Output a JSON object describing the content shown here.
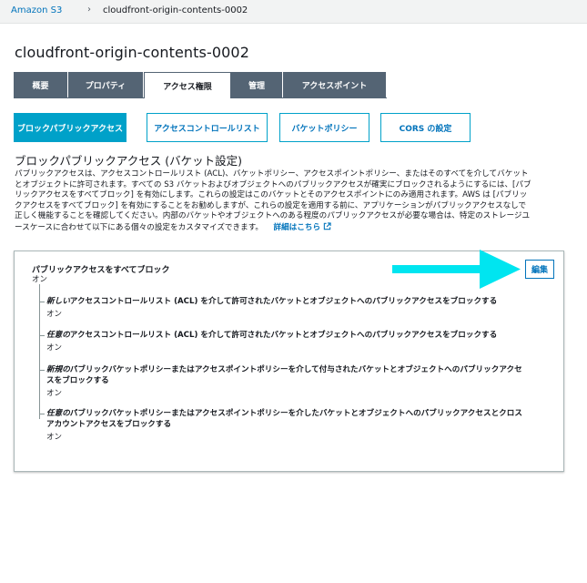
{
  "breadcrumb": {
    "root": "Amazon S3",
    "separator": "›",
    "current": "cloudfront-origin-contents-0002"
  },
  "bucket_title": "cloudfront-origin-contents-0002",
  "tabs": [
    {
      "label": "概要",
      "active": false
    },
    {
      "label": "プロパティ",
      "active": false
    },
    {
      "label": "アクセス権限",
      "active": true
    },
    {
      "label": "管理",
      "active": false
    },
    {
      "label": "アクセスポイント",
      "active": false
    }
  ],
  "subtabs": [
    {
      "label": "ブロックパブリックアクセス",
      "active": true
    },
    {
      "label": "アクセスコントロールリスト",
      "active": false
    },
    {
      "label": "バケットポリシー",
      "active": false
    },
    {
      "label": "CORS の設定",
      "active": false
    }
  ],
  "section": {
    "heading": "ブロックパブリックアクセス (バケット設定)",
    "lines": [
      "パブリックアクセスは、アクセスコントロールリスト (ACL)、バケットポリシー、アクセスポイントポリシー、またはそのすべてを介してバケット",
      "とオブジェクトに許可されます。すべての S3 バケットおよびオブジェクトへのパブリックアクセスが確実にブロックされるようにするには、[パブ",
      "リックアクセスをすべてブロック] を有効にします。これらの設定はこのバケットとそのアクセスポイントにのみ適用されます。AWS は [パブリッ",
      "クアクセスをすべてブロック] を有効にすることをお勧めしますが、これらの設定を適用する前に、アプリケーションがパブリックアクセスなしで",
      "正しく機能することを確認してください。内部のバケットやオブジェクトへのある程度のパブリックアクセスが必要な場合は、特定のストレージユ"
    ],
    "last_line": "ースケースに合わせて以下にある個々の設定をカスタマイズできます。",
    "link": "詳細はこちら",
    "link_icon": "external-link-icon"
  },
  "panel": {
    "edit_label": "編集",
    "arrow_color": "#00e5f0",
    "main": {
      "label": "パブリックアクセスをすべてブロック",
      "value": "オン"
    },
    "options": [
      {
        "em": "新しい",
        "text": "アクセスコントロールリスト (ACL) を介して許可されたバケットとオブジェクトへのパブリックアクセスをブロックする",
        "value": "オン"
      },
      {
        "em": "任意の",
        "text": "アクセスコントロールリスト (ACL) を介して許可されたバケットとオブジェクトへのパブリックアクセスをブロックする",
        "value": "オン"
      },
      {
        "em": "新規の",
        "text": "パブリックバケットポリシーまたはアクセスポイントポリシーを介して付与されたバケットとオブジェクトへのパブリックアクセ",
        "text2": "スをブロックする",
        "value": "オン"
      },
      {
        "em": "任意の",
        "text": "パブリックバケットポリシーまたはアクセスポイントポリシーを介したバケットとオブジェクトへのパブリックアクセスとクロス",
        "text2": "アカウントアクセスをブロックする",
        "value": "オン"
      }
    ]
  }
}
